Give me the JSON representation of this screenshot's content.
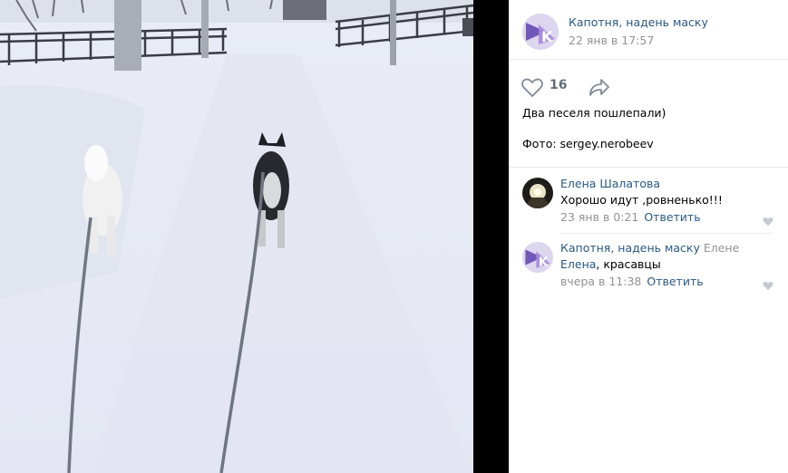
{
  "post": {
    "author": "Капотня, надень маску",
    "date": "22 янв в 17:57",
    "likes": "16",
    "text_line1": "Два песеля пошлепали)",
    "text_line2": "Фото: sergey.nerobeev",
    "photo_icon": "photo-dogs-on-snow"
  },
  "comments": [
    {
      "author": "Елена Шалатова",
      "reply_to": "",
      "text": "Хорошо идут ,ровненько!!!",
      "mention": "",
      "time": "23 янв в 0:21",
      "reply_label": "Ответить",
      "avatar_icon": "avatar-lamp-icon"
    },
    {
      "author": "Капотня, надень маску",
      "reply_to": "Елене",
      "mention": "Елена",
      "text": ", красавцы",
      "time": "вчера в 11:38",
      "reply_label": "Ответить",
      "avatar_icon": "avatar-community-icon"
    }
  ],
  "colors": {
    "link": "#2a5885",
    "muted": "#939393",
    "divider": "#e7e8ec"
  }
}
